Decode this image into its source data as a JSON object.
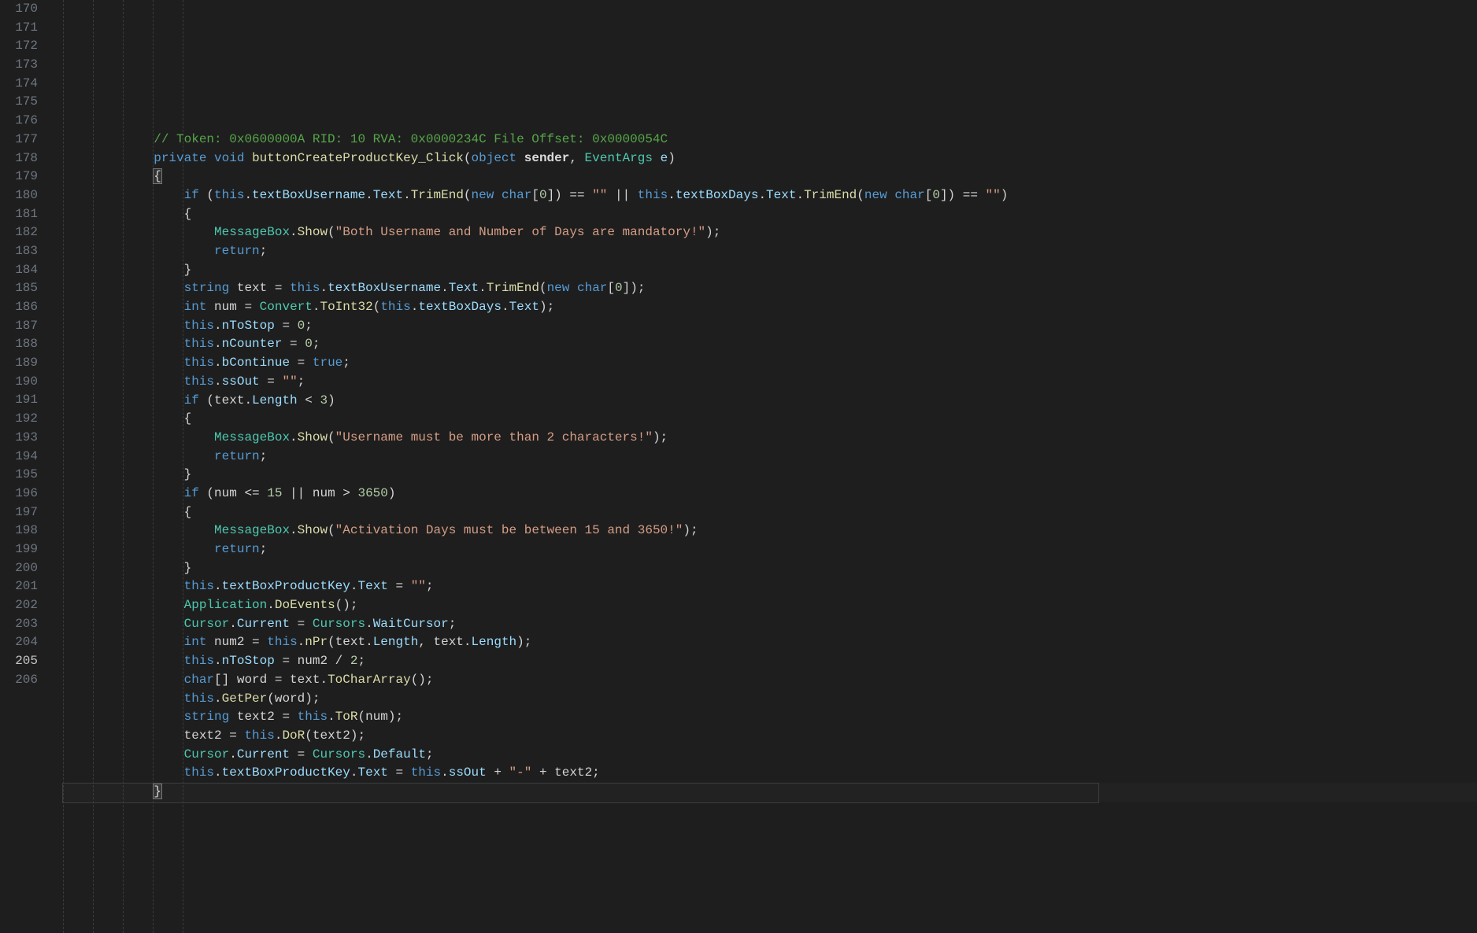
{
  "startLine": 170,
  "activeLine": 205,
  "lines": [
    {
      "indent": 3,
      "tokens": [
        {
          "t": "// Token: 0x0600000A RID: 10 RVA: 0x0000234C File Offset: 0x0000054C",
          "c": "c-comment"
        }
      ]
    },
    {
      "indent": 3,
      "tokens": [
        {
          "t": "private",
          "c": "c-keyword"
        },
        {
          "t": " "
        },
        {
          "t": "void",
          "c": "c-keyword"
        },
        {
          "t": " "
        },
        {
          "t": "buttonCreateProductKey_Click",
          "c": "c-method"
        },
        {
          "t": "("
        },
        {
          "t": "object",
          "c": "c-keyword"
        },
        {
          "t": " "
        },
        {
          "t": "sender",
          "c": "c-bold"
        },
        {
          "t": ", "
        },
        {
          "t": "EventArgs",
          "c": "c-type"
        },
        {
          "t": " "
        },
        {
          "t": "e",
          "c": "c-param"
        },
        {
          "t": ")"
        }
      ]
    },
    {
      "indent": 3,
      "tokens": [
        {
          "t": "{",
          "c": "c-bracematch"
        }
      ]
    },
    {
      "indent": 4,
      "tokens": [
        {
          "t": "if",
          "c": "c-keyword"
        },
        {
          "t": " ("
        },
        {
          "t": "this",
          "c": "c-keyword"
        },
        {
          "t": "."
        },
        {
          "t": "textBoxUsername",
          "c": "c-field"
        },
        {
          "t": "."
        },
        {
          "t": "Text",
          "c": "c-field"
        },
        {
          "t": "."
        },
        {
          "t": "TrimEnd",
          "c": "c-method"
        },
        {
          "t": "("
        },
        {
          "t": "new",
          "c": "c-keyword"
        },
        {
          "t": " "
        },
        {
          "t": "char",
          "c": "c-keyword"
        },
        {
          "t": "["
        },
        {
          "t": "0",
          "c": "c-number"
        },
        {
          "t": "]) == "
        },
        {
          "t": "\"\"",
          "c": "c-string"
        },
        {
          "t": " || "
        },
        {
          "t": "this",
          "c": "c-keyword"
        },
        {
          "t": "."
        },
        {
          "t": "textBoxDays",
          "c": "c-field"
        },
        {
          "t": "."
        },
        {
          "t": "Text",
          "c": "c-field"
        },
        {
          "t": "."
        },
        {
          "t": "TrimEnd",
          "c": "c-method"
        },
        {
          "t": "("
        },
        {
          "t": "new",
          "c": "c-keyword"
        },
        {
          "t": " "
        },
        {
          "t": "char",
          "c": "c-keyword"
        },
        {
          "t": "["
        },
        {
          "t": "0",
          "c": "c-number"
        },
        {
          "t": "]) == "
        },
        {
          "t": "\"\"",
          "c": "c-string"
        },
        {
          "t": ")"
        }
      ]
    },
    {
      "indent": 4,
      "tokens": [
        {
          "t": "{"
        }
      ]
    },
    {
      "indent": 5,
      "tokens": [
        {
          "t": "MessageBox",
          "c": "c-type"
        },
        {
          "t": "."
        },
        {
          "t": "Show",
          "c": "c-method"
        },
        {
          "t": "("
        },
        {
          "t": "\"Both Username and Number of Days are mandatory!\"",
          "c": "c-string"
        },
        {
          "t": ");"
        }
      ]
    },
    {
      "indent": 5,
      "tokens": [
        {
          "t": "return",
          "c": "c-keyword"
        },
        {
          "t": ";"
        }
      ]
    },
    {
      "indent": 4,
      "tokens": [
        {
          "t": "}"
        }
      ]
    },
    {
      "indent": 4,
      "tokens": [
        {
          "t": "string",
          "c": "c-keyword"
        },
        {
          "t": " "
        },
        {
          "t": "text",
          "c": "c-ident"
        },
        {
          "t": " = "
        },
        {
          "t": "this",
          "c": "c-keyword"
        },
        {
          "t": "."
        },
        {
          "t": "textBoxUsername",
          "c": "c-field"
        },
        {
          "t": "."
        },
        {
          "t": "Text",
          "c": "c-field"
        },
        {
          "t": "."
        },
        {
          "t": "TrimEnd",
          "c": "c-method"
        },
        {
          "t": "("
        },
        {
          "t": "new",
          "c": "c-keyword"
        },
        {
          "t": " "
        },
        {
          "t": "char",
          "c": "c-keyword"
        },
        {
          "t": "["
        },
        {
          "t": "0",
          "c": "c-number"
        },
        {
          "t": "]);"
        }
      ]
    },
    {
      "indent": 4,
      "tokens": [
        {
          "t": "int",
          "c": "c-keyword"
        },
        {
          "t": " "
        },
        {
          "t": "num",
          "c": "c-ident"
        },
        {
          "t": " = "
        },
        {
          "t": "Convert",
          "c": "c-type"
        },
        {
          "t": "."
        },
        {
          "t": "ToInt32",
          "c": "c-method"
        },
        {
          "t": "("
        },
        {
          "t": "this",
          "c": "c-keyword"
        },
        {
          "t": "."
        },
        {
          "t": "textBoxDays",
          "c": "c-field"
        },
        {
          "t": "."
        },
        {
          "t": "Text",
          "c": "c-field"
        },
        {
          "t": ");"
        }
      ]
    },
    {
      "indent": 4,
      "tokens": [
        {
          "t": "this",
          "c": "c-keyword"
        },
        {
          "t": "."
        },
        {
          "t": "nToStop",
          "c": "c-field"
        },
        {
          "t": " = "
        },
        {
          "t": "0",
          "c": "c-number"
        },
        {
          "t": ";"
        }
      ]
    },
    {
      "indent": 4,
      "tokens": [
        {
          "t": "this",
          "c": "c-keyword"
        },
        {
          "t": "."
        },
        {
          "t": "nCounter",
          "c": "c-field"
        },
        {
          "t": " = "
        },
        {
          "t": "0",
          "c": "c-number"
        },
        {
          "t": ";"
        }
      ]
    },
    {
      "indent": 4,
      "tokens": [
        {
          "t": "this",
          "c": "c-keyword"
        },
        {
          "t": "."
        },
        {
          "t": "bContinue",
          "c": "c-field"
        },
        {
          "t": " = "
        },
        {
          "t": "true",
          "c": "c-keyword"
        },
        {
          "t": ";"
        }
      ]
    },
    {
      "indent": 4,
      "tokens": [
        {
          "t": "this",
          "c": "c-keyword"
        },
        {
          "t": "."
        },
        {
          "t": "ssOut",
          "c": "c-field"
        },
        {
          "t": " = "
        },
        {
          "t": "\"\"",
          "c": "c-string"
        },
        {
          "t": ";"
        }
      ]
    },
    {
      "indent": 4,
      "tokens": [
        {
          "t": "if",
          "c": "c-keyword"
        },
        {
          "t": " (text."
        },
        {
          "t": "Length",
          "c": "c-field"
        },
        {
          "t": " < "
        },
        {
          "t": "3",
          "c": "c-number"
        },
        {
          "t": ")"
        }
      ]
    },
    {
      "indent": 4,
      "tokens": [
        {
          "t": "{"
        }
      ]
    },
    {
      "indent": 5,
      "tokens": [
        {
          "t": "MessageBox",
          "c": "c-type"
        },
        {
          "t": "."
        },
        {
          "t": "Show",
          "c": "c-method"
        },
        {
          "t": "("
        },
        {
          "t": "\"Username must be more than 2 characters!\"",
          "c": "c-string"
        },
        {
          "t": ");"
        }
      ]
    },
    {
      "indent": 5,
      "tokens": [
        {
          "t": "return",
          "c": "c-keyword"
        },
        {
          "t": ";"
        }
      ]
    },
    {
      "indent": 4,
      "tokens": [
        {
          "t": "}"
        }
      ]
    },
    {
      "indent": 4,
      "tokens": [
        {
          "t": "if",
          "c": "c-keyword"
        },
        {
          "t": " (num <= "
        },
        {
          "t": "15",
          "c": "c-number"
        },
        {
          "t": " || num > "
        },
        {
          "t": "3650",
          "c": "c-number"
        },
        {
          "t": ")"
        }
      ]
    },
    {
      "indent": 4,
      "tokens": [
        {
          "t": "{"
        }
      ]
    },
    {
      "indent": 5,
      "tokens": [
        {
          "t": "MessageBox",
          "c": "c-type"
        },
        {
          "t": "."
        },
        {
          "t": "Show",
          "c": "c-method"
        },
        {
          "t": "("
        },
        {
          "t": "\"Activation Days must be between 15 and 3650!\"",
          "c": "c-string"
        },
        {
          "t": ");"
        }
      ]
    },
    {
      "indent": 5,
      "tokens": [
        {
          "t": "return",
          "c": "c-keyword"
        },
        {
          "t": ";"
        }
      ]
    },
    {
      "indent": 4,
      "tokens": [
        {
          "t": "}"
        }
      ]
    },
    {
      "indent": 4,
      "tokens": [
        {
          "t": "this",
          "c": "c-keyword"
        },
        {
          "t": "."
        },
        {
          "t": "textBoxProductKey",
          "c": "c-field"
        },
        {
          "t": "."
        },
        {
          "t": "Text",
          "c": "c-field"
        },
        {
          "t": " = "
        },
        {
          "t": "\"\"",
          "c": "c-string"
        },
        {
          "t": ";"
        }
      ]
    },
    {
      "indent": 4,
      "tokens": [
        {
          "t": "Application",
          "c": "c-type"
        },
        {
          "t": "."
        },
        {
          "t": "DoEvents",
          "c": "c-method"
        },
        {
          "t": "();"
        }
      ]
    },
    {
      "indent": 4,
      "tokens": [
        {
          "t": "Cursor",
          "c": "c-type"
        },
        {
          "t": "."
        },
        {
          "t": "Current",
          "c": "c-field"
        },
        {
          "t": " = "
        },
        {
          "t": "Cursors",
          "c": "c-type"
        },
        {
          "t": "."
        },
        {
          "t": "WaitCursor",
          "c": "c-field"
        },
        {
          "t": ";"
        }
      ]
    },
    {
      "indent": 4,
      "tokens": [
        {
          "t": "int",
          "c": "c-keyword"
        },
        {
          "t": " "
        },
        {
          "t": "num2",
          "c": "c-ident"
        },
        {
          "t": " = "
        },
        {
          "t": "this",
          "c": "c-keyword"
        },
        {
          "t": "."
        },
        {
          "t": "nPr",
          "c": "c-method"
        },
        {
          "t": "(text."
        },
        {
          "t": "Length",
          "c": "c-field"
        },
        {
          "t": ", text."
        },
        {
          "t": "Length",
          "c": "c-field"
        },
        {
          "t": ");"
        }
      ]
    },
    {
      "indent": 4,
      "tokens": [
        {
          "t": "this",
          "c": "c-keyword"
        },
        {
          "t": "."
        },
        {
          "t": "nToStop",
          "c": "c-field"
        },
        {
          "t": " = num2 / "
        },
        {
          "t": "2",
          "c": "c-number"
        },
        {
          "t": ";"
        }
      ]
    },
    {
      "indent": 4,
      "tokens": [
        {
          "t": "char",
          "c": "c-keyword"
        },
        {
          "t": "[] "
        },
        {
          "t": "word",
          "c": "c-ident"
        },
        {
          "t": " = text."
        },
        {
          "t": "ToCharArray",
          "c": "c-method"
        },
        {
          "t": "();"
        }
      ]
    },
    {
      "indent": 4,
      "tokens": [
        {
          "t": "this",
          "c": "c-keyword"
        },
        {
          "t": "."
        },
        {
          "t": "GetPer",
          "c": "c-method"
        },
        {
          "t": "(word);"
        }
      ]
    },
    {
      "indent": 4,
      "tokens": [
        {
          "t": "string",
          "c": "c-keyword"
        },
        {
          "t": " "
        },
        {
          "t": "text2",
          "c": "c-ident"
        },
        {
          "t": " = "
        },
        {
          "t": "this",
          "c": "c-keyword"
        },
        {
          "t": "."
        },
        {
          "t": "ToR",
          "c": "c-method"
        },
        {
          "t": "(num);"
        }
      ]
    },
    {
      "indent": 4,
      "tokens": [
        {
          "t": "text2 = "
        },
        {
          "t": "this",
          "c": "c-keyword"
        },
        {
          "t": "."
        },
        {
          "t": "DoR",
          "c": "c-method"
        },
        {
          "t": "(text2);"
        }
      ]
    },
    {
      "indent": 4,
      "tokens": [
        {
          "t": "Cursor",
          "c": "c-type"
        },
        {
          "t": "."
        },
        {
          "t": "Current",
          "c": "c-field"
        },
        {
          "t": " = "
        },
        {
          "t": "Cursors",
          "c": "c-type"
        },
        {
          "t": "."
        },
        {
          "t": "Default",
          "c": "c-field"
        },
        {
          "t": ";"
        }
      ]
    },
    {
      "indent": 4,
      "tokens": [
        {
          "t": "this",
          "c": "c-keyword"
        },
        {
          "t": "."
        },
        {
          "t": "textBoxProductKey",
          "c": "c-field"
        },
        {
          "t": "."
        },
        {
          "t": "Text",
          "c": "c-field"
        },
        {
          "t": " = "
        },
        {
          "t": "this",
          "c": "c-keyword"
        },
        {
          "t": "."
        },
        {
          "t": "ssOut",
          "c": "c-field"
        },
        {
          "t": " + "
        },
        {
          "t": "\"-\"",
          "c": "c-string"
        },
        {
          "t": " + text2;"
        }
      ]
    },
    {
      "indent": 3,
      "tokens": [
        {
          "t": "}",
          "c": "c-bracematch"
        }
      ]
    },
    {
      "indent": 0,
      "tokens": []
    }
  ]
}
